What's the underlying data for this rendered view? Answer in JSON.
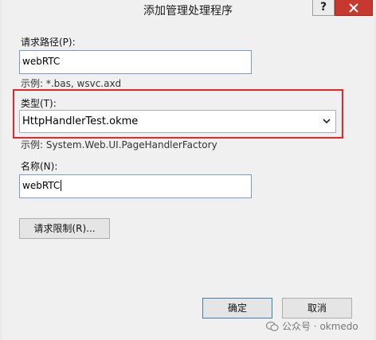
{
  "window": {
    "title": "添加管理处理程序",
    "help_label": "?",
    "accent_close": "#c7382f"
  },
  "request_path": {
    "label": "请求路径(P):",
    "value": "webRTC",
    "example": "示例: *.bas, wsvc.axd"
  },
  "type": {
    "label": "类型(T):",
    "selected": "HttpHandlerTest.okme",
    "example": "示例: System.Web.UI.PageHandlerFactory",
    "highlight_color": "#e8252b"
  },
  "name": {
    "label": "名称(N):",
    "value": "webRTC"
  },
  "buttons": {
    "restrictions": "请求限制(R)...",
    "ok": "确定",
    "cancel": "取消"
  },
  "watermark": {
    "text": "公众号 · okmedo"
  }
}
